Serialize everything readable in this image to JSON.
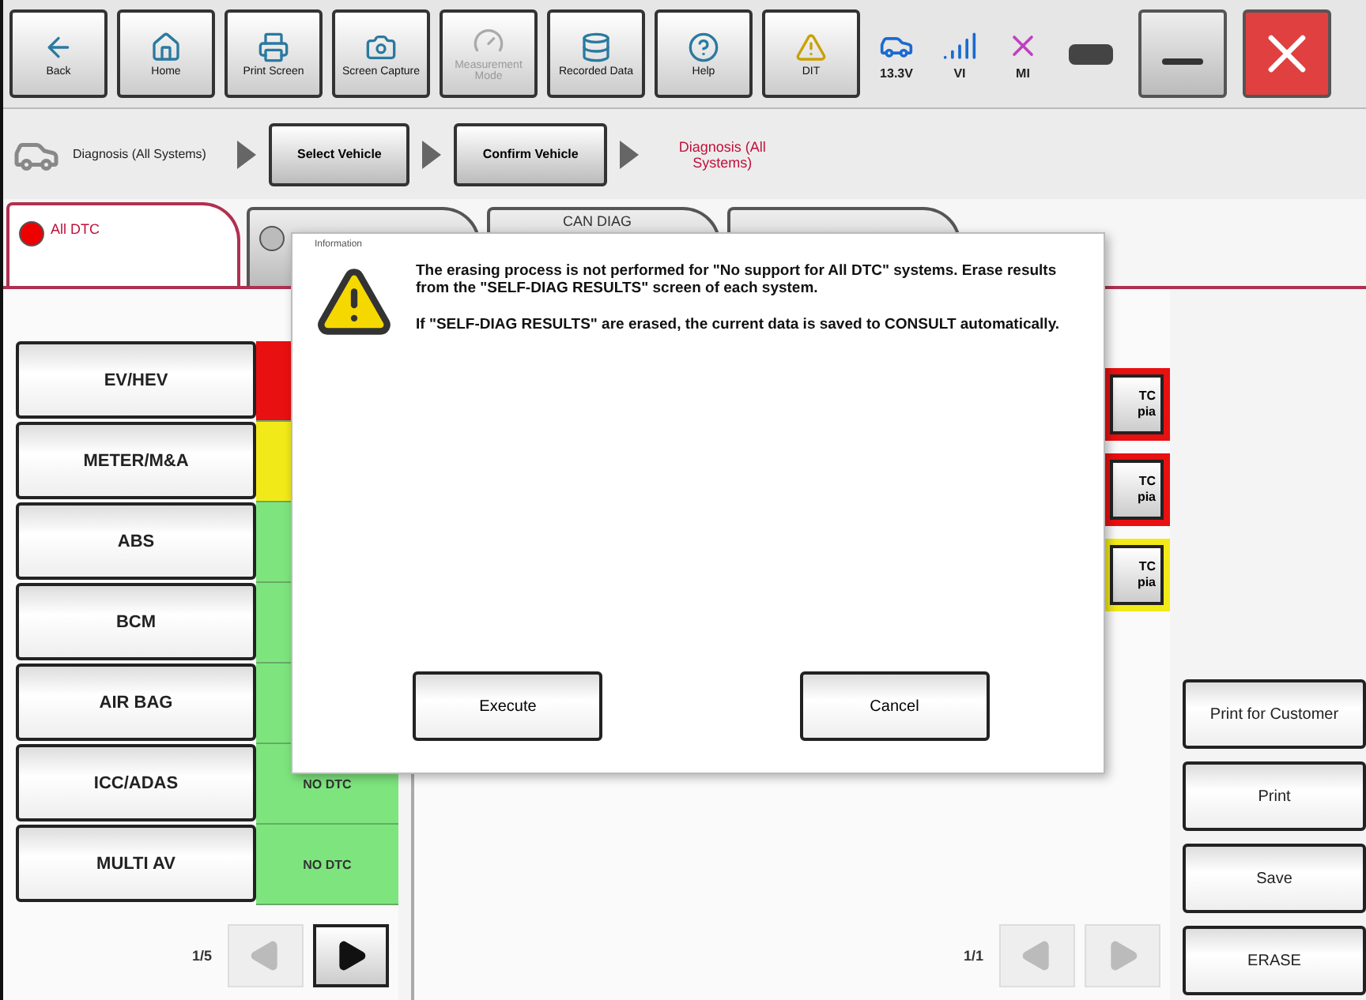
{
  "toolbar": [
    {
      "label": "Back",
      "disabled": false
    },
    {
      "label": "Home",
      "disabled": false
    },
    {
      "label": "Print Screen",
      "disabled": false
    },
    {
      "label": "Screen Capture",
      "disabled": false
    },
    {
      "label": "Measurement Mode",
      "disabled": true
    },
    {
      "label": "Recorded Data",
      "disabled": false
    },
    {
      "label": "Help",
      "disabled": false
    },
    {
      "label": "DIT",
      "disabled": false
    }
  ],
  "status": [
    {
      "label": "13.3V"
    },
    {
      "label": "VI"
    },
    {
      "label": "MI"
    }
  ],
  "breadcrumb": {
    "title": "Diagnosis (All Systems)",
    "steps": [
      {
        "label": "Select Vehicle",
        "kind": "button"
      },
      {
        "label": "Confirm Vehicle",
        "kind": "button"
      },
      {
        "label": "Diagnosis (All Systems)",
        "kind": "current"
      }
    ]
  },
  "tabs": [
    {
      "label": "All DTC",
      "selected": true
    },
    {
      "selected": false
    },
    {
      "label": "CAN DIAG",
      "selected": false
    },
    {
      "selected": false
    }
  ],
  "systems": [
    {
      "name": "EV/HEV",
      "color": "#e81010"
    },
    {
      "name": "METER/M&A",
      "color": "#f2ea18"
    },
    {
      "name": "ABS",
      "color": "#7ee57e"
    },
    {
      "name": "BCM",
      "color": "#7ee57e"
    },
    {
      "name": "AIR BAG",
      "color": "#7ee57e"
    },
    {
      "name": "ICC/ADAS",
      "color": "#7ee57e",
      "status": "NO DTC"
    },
    {
      "name": "MULTI AV",
      "color": "#7ee57e",
      "status": "NO DTC"
    }
  ],
  "left_pager": {
    "page": "1/5",
    "prev_disabled": true,
    "next_disabled": false
  },
  "results": [
    {
      "color": "#e81010",
      "lines": [
        "TC",
        "pia"
      ]
    },
    {
      "color": "#e81010",
      "lines": [
        "TC",
        "pia"
      ]
    },
    {
      "color": "#f2ea18",
      "lines": [
        "TC",
        "pia"
      ]
    }
  ],
  "results_pager": {
    "page": "1/1",
    "prev_disabled": true,
    "next_disabled": true
  },
  "actions": [
    "Print for Customer",
    "Print",
    "Save",
    "ERASE"
  ],
  "dialog": {
    "title": "Information",
    "paragraphs": [
      "The erasing process is not performed for \"No support for All DTC\" systems. Erase results from the \"SELF-DIAG RESULTS\" screen of each system.",
      "If \"SELF-DIAG RESULTS\" are erased, the current data is saved to CONSULT automatically."
    ],
    "buttons": [
      "Execute",
      "Cancel"
    ]
  }
}
